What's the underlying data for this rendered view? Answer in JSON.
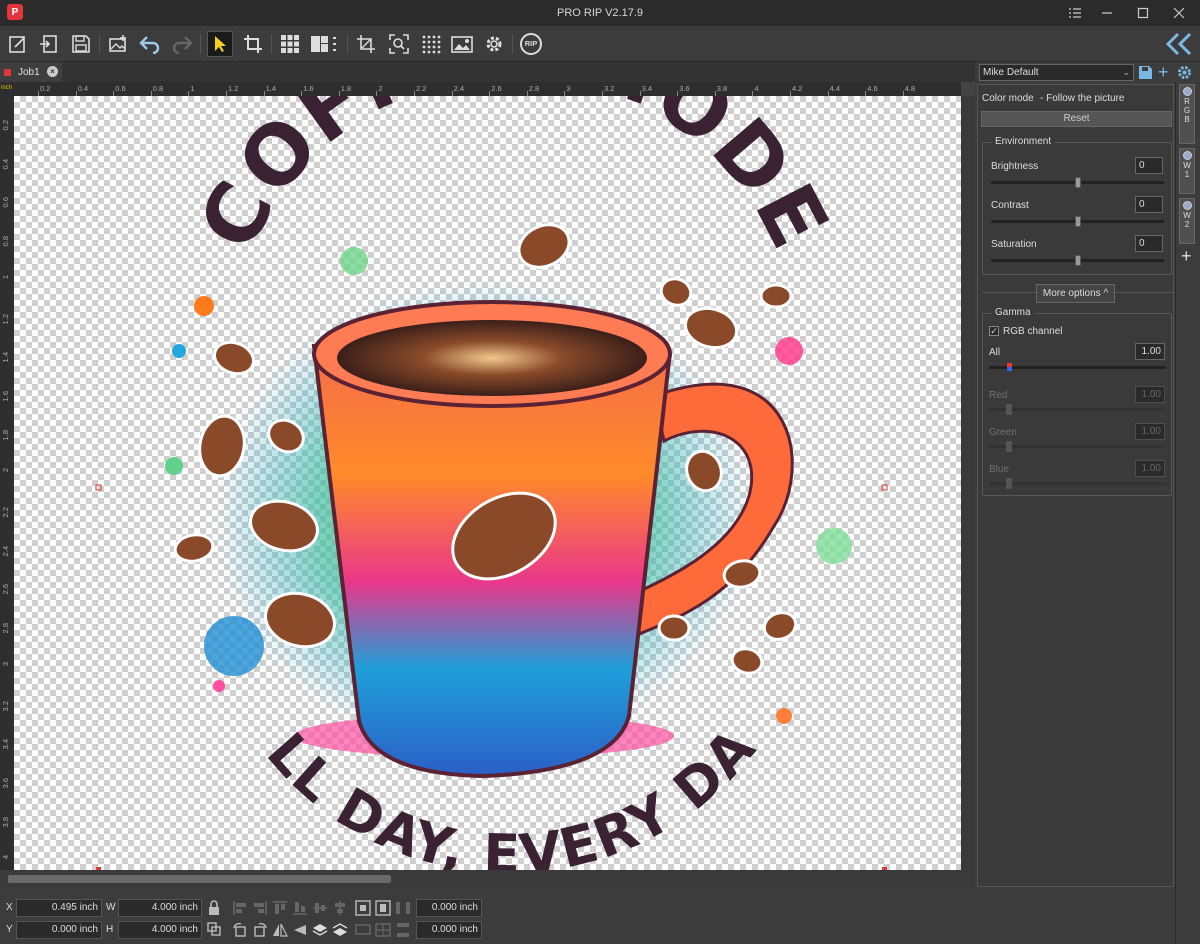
{
  "window": {
    "title": "PRO RIP V2.17.9",
    "logo": "P"
  },
  "toolbar": {
    "items": [
      "new-job-icon",
      "import-icon",
      "save-icon",
      "add-image-icon",
      "undo-icon",
      "redo-icon",
      "select-arrow-icon",
      "crop-icon",
      "grid-icon",
      "layout-icon",
      "fit-icon",
      "zoom-fit-icon",
      "dots-grid-icon",
      "image-adjust-icon",
      "settings-gear-icon",
      "rip-icon"
    ],
    "rip_label": "RIP",
    "collapse_icon": "double-chevron-left-icon"
  },
  "tab": {
    "label": "Job1"
  },
  "ruler": {
    "unit": "inch",
    "top": [
      "0.2",
      "0.4",
      "0.6",
      "0.8",
      "1",
      "1.2",
      "1.4",
      "1.6",
      "1.8",
      "2",
      "2.2",
      "2.4",
      "2.6",
      "2.8",
      "3",
      "3.2",
      "3.4",
      "3.6",
      "3.8",
      "4",
      "4.2",
      "4.4",
      "4.6",
      "4.8"
    ],
    "left": [
      "0.2",
      "0.4",
      "0.6",
      "0.8",
      "1",
      "1.2",
      "1.4",
      "1.6",
      "1.8",
      "2",
      "2.2",
      "2.4",
      "2.6",
      "2.8",
      "3",
      "3.2",
      "3.4",
      "3.6",
      "3.8",
      "4"
    ]
  },
  "artwork": {
    "headline": "COFFEE MODE",
    "tagline": "ALL DAY, EVERY DAY"
  },
  "position": {
    "x_label": "X",
    "x_value": "0.495 inch",
    "y_label": "Y",
    "y_value": "0.000 inch",
    "w_label": "W",
    "w_value": "4.000 inch",
    "h_label": "H",
    "h_value": "4.000 inch",
    "offset1": "0.000 inch",
    "offset2": "0.000 inch"
  },
  "panel": {
    "preset": "Mike Default",
    "color_mode_label": "Color mode",
    "color_mode_value": "- Follow the picture",
    "reset_label": "Reset",
    "environment": {
      "title": "Environment",
      "brightness_label": "Brightness",
      "brightness": "0",
      "brightness_level": 0.5,
      "contrast_label": "Contrast",
      "contrast": "0",
      "contrast_level": 0.5,
      "saturation_label": "Saturation",
      "saturation": "0",
      "saturation_level": 0.5
    },
    "more_options": "More options ^",
    "gamma": {
      "title": "Gamma",
      "rgb_channel_label": "RGB channel",
      "all_label": "All",
      "all_value": "1.00",
      "red_label": "Red",
      "red_value": "1.00",
      "green_label": "Green",
      "green_value": "1.00",
      "blue_label": "Blue",
      "blue_value": "1.00"
    }
  },
  "side_tabs": [
    {
      "label": "RGB"
    },
    {
      "label": "W1"
    },
    {
      "label": "W2"
    }
  ],
  "colors": {
    "accent": "#e0363c",
    "tab_dot": "#99aacc"
  }
}
